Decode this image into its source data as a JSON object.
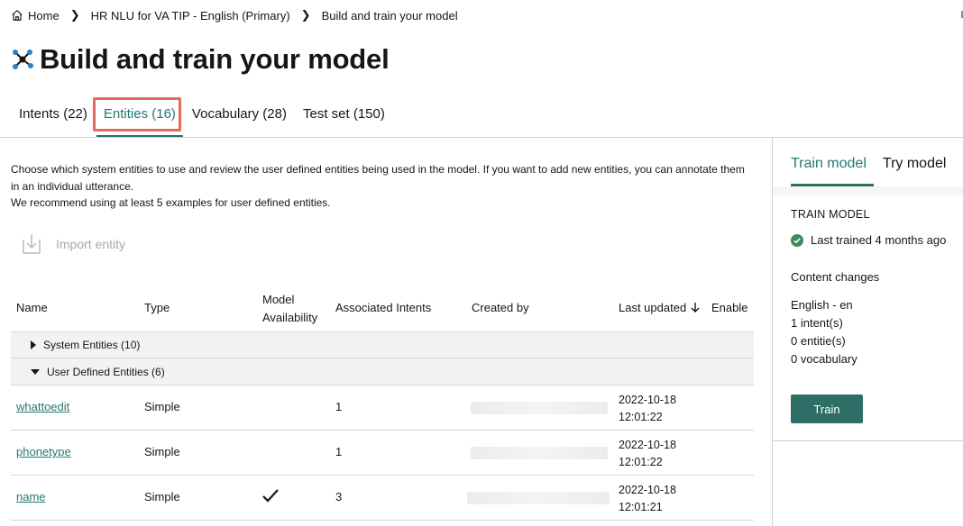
{
  "breadcrumb": {
    "home": "Home",
    "project": "HR NLU for VA TIP - English (Primary)",
    "current": "Build and train your model"
  },
  "page": {
    "title": "Build and train your model",
    "icon": "model-network-icon"
  },
  "tabs": [
    {
      "label": "Intents (22)"
    },
    {
      "label": "Entities (16)",
      "active": true
    },
    {
      "label": "Vocabulary (28)"
    },
    {
      "label": "Test set (150)"
    }
  ],
  "main": {
    "description_1": "Choose which system entities to use and review the user defined entities being used in the model. If you want to add new entities, you can annotate them in an individual utterance.",
    "description_2": "We recommend using at least 5 examples for user defined entities.",
    "import_label": "Import entity"
  },
  "table": {
    "headers": {
      "name": "Name",
      "type": "Type",
      "model_availability_1": "Model",
      "model_availability_2": "Availability",
      "associated_intents": "Associated Intents",
      "created_by": "Created by",
      "last_updated": "Last updated",
      "enable": "Enable"
    },
    "groups": {
      "system": "System Entities (10)",
      "user": "User Defined Entities (6)"
    },
    "rows": [
      {
        "name": "whattoedit",
        "type": "Simple",
        "intents": "1",
        "date": "2022-10-18",
        "time": "12:01:22",
        "available": false
      },
      {
        "name": "phonetype",
        "type": "Simple",
        "intents": "1",
        "date": "2022-10-18",
        "time": "12:01:22",
        "available": false
      },
      {
        "name": "name",
        "type": "Simple",
        "intents": "3",
        "date": "2022-10-18",
        "time": "12:01:21",
        "available": true
      }
    ]
  },
  "right_panel": {
    "tabs": [
      {
        "label": "Train model",
        "active": true
      },
      {
        "label": "Try model"
      }
    ],
    "heading": "TRAIN MODEL",
    "status": "Last trained 4 months ago",
    "content_changes_label": "Content changes",
    "changes": {
      "language": "English - en",
      "intents": "1 intent(s)",
      "entities": "0 entitie(s)",
      "vocabulary": "0 vocabulary"
    },
    "train_button": "Train"
  },
  "colors": {
    "accent": "#24796e",
    "button": "#2e6e66",
    "highlight": "#e46a5e",
    "success": "#3d8a5f"
  }
}
